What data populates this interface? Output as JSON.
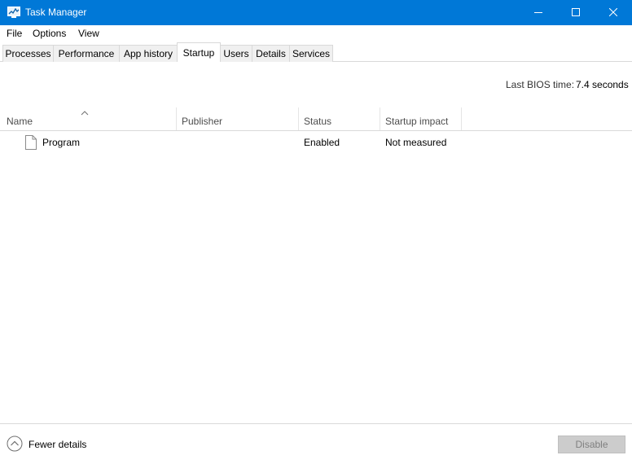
{
  "window": {
    "title": "Task Manager",
    "app_icon": "task-manager-icon",
    "controls": [
      "minimize-icon",
      "maximize-icon",
      "close-icon"
    ],
    "accent_color": "#0078d7"
  },
  "menu": [
    "File",
    "Options",
    "View"
  ],
  "tabs": [
    "Processes",
    "Performance",
    "App history",
    "Startup",
    "Users",
    "Details",
    "Services"
  ],
  "active_tab": "Startup",
  "bios": {
    "label": "Last BIOS time:",
    "value": "7.4 seconds"
  },
  "table": {
    "sorted_column": "Name",
    "sort_icon": "sort-ascending-icon",
    "columns": [
      "Name",
      "Publisher",
      "Status",
      "Startup impact"
    ],
    "rows": [
      {
        "icon": "file-icon",
        "name": "Program",
        "publisher": "",
        "status": "Enabled",
        "impact": "Not measured"
      }
    ]
  },
  "footer": {
    "fewer_details_icon": "chevron-up-circle-icon",
    "fewer_details": "Fewer details",
    "disable_button": "Disable",
    "disable_enabled": false
  }
}
